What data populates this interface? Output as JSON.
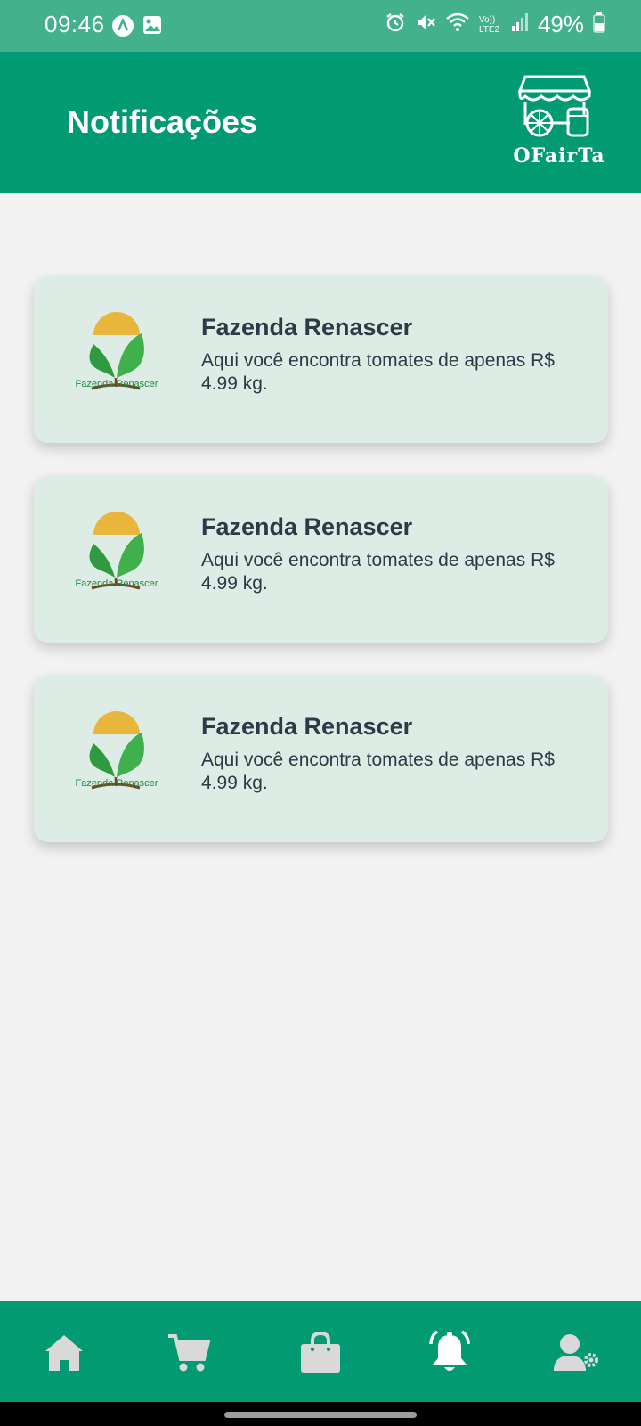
{
  "status_bar": {
    "time": "09:46",
    "battery": "49%",
    "network_label": "Vo)) LTE2"
  },
  "header": {
    "title": "Notificações",
    "brand_name": "OFairTa"
  },
  "notifications": [
    {
      "logo_text": "Fazenda Renascer",
      "title": "Fazenda Renascer",
      "message": "Aqui você encontra tomates de apenas R$ 4.99 kg."
    },
    {
      "logo_text": "Fazenda Renascer",
      "title": "Fazenda Renascer",
      "message": "Aqui você encontra tomates de apenas R$ 4.99 kg."
    },
    {
      "logo_text": "Fazenda Renascer",
      "title": "Fazenda Renascer",
      "message": "Aqui você encontra tomates de apenas R$ 4.99 kg."
    }
  ],
  "bottom_nav": {
    "items": [
      {
        "icon": "home-icon",
        "active": false
      },
      {
        "icon": "cart-icon",
        "active": false
      },
      {
        "icon": "shopping-bag-icon",
        "active": false
      },
      {
        "icon": "bell-icon",
        "active": true
      },
      {
        "icon": "user-settings-icon",
        "active": false
      }
    ]
  },
  "colors": {
    "status_bar": "#42b18c",
    "primary": "#019a72",
    "card_background": "#deece6",
    "page_background": "#f2f2f2",
    "text_dark": "#2e3a45",
    "nav_inactive": "#d9d9d9",
    "nav_active": "#ffffff"
  }
}
